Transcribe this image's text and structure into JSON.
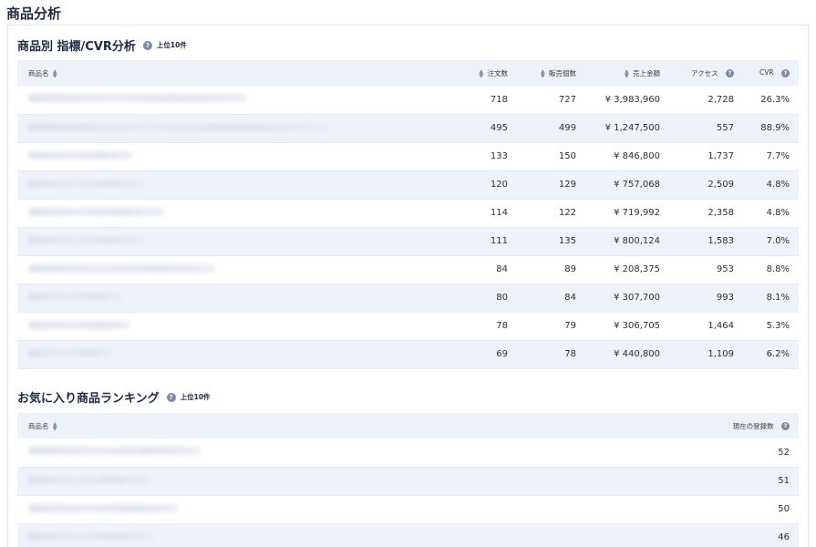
{
  "page": {
    "title": "商品分析"
  },
  "cvr_section": {
    "title": "商品別 指標/CVR分析",
    "help_icon": "question-icon",
    "badge": "上位10件",
    "columns": {
      "name": "商品名",
      "orders": "注文数",
      "units": "販売個数",
      "sales": "売上金額",
      "access": "アクセス",
      "cvr": "CVR"
    },
    "rows": [
      {
        "orders": "718",
        "units": "727",
        "sales": "¥ 3,983,960",
        "access": "2,728",
        "cvr": "26.3%"
      },
      {
        "orders": "495",
        "units": "499",
        "sales": "¥ 1,247,500",
        "access": "557",
        "cvr": "88.9%"
      },
      {
        "orders": "133",
        "units": "150",
        "sales": "¥ 846,800",
        "access": "1,737",
        "cvr": "7.7%"
      },
      {
        "orders": "120",
        "units": "129",
        "sales": "¥ 757,068",
        "access": "2,509",
        "cvr": "4.8%"
      },
      {
        "orders": "114",
        "units": "122",
        "sales": "¥ 719,992",
        "access": "2,358",
        "cvr": "4.8%"
      },
      {
        "orders": "111",
        "units": "135",
        "sales": "¥ 800,124",
        "access": "1,583",
        "cvr": "7.0%"
      },
      {
        "orders": "84",
        "units": "89",
        "sales": "¥ 208,375",
        "access": "953",
        "cvr": "8.8%"
      },
      {
        "orders": "80",
        "units": "84",
        "sales": "¥ 307,700",
        "access": "993",
        "cvr": "8.1%"
      },
      {
        "orders": "78",
        "units": "79",
        "sales": "¥ 306,705",
        "access": "1,464",
        "cvr": "5.3%"
      },
      {
        "orders": "69",
        "units": "78",
        "sales": "¥ 440,800",
        "access": "1,109",
        "cvr": "6.2%"
      }
    ]
  },
  "favorites_section": {
    "title": "お気に入り商品ランキング",
    "help_icon": "question-icon",
    "badge": "上位10件",
    "columns": {
      "name": "商品名",
      "count": "現在の登録数"
    },
    "rows": [
      {
        "count": "52"
      },
      {
        "count": "51"
      },
      {
        "count": "50"
      },
      {
        "count": "46"
      }
    ]
  },
  "colors": {
    "header_bg": "#edf1f8",
    "stripe_bg": "#eef2fa",
    "title_text": "#1e2a44",
    "icon_gray": "#7f89a3"
  }
}
